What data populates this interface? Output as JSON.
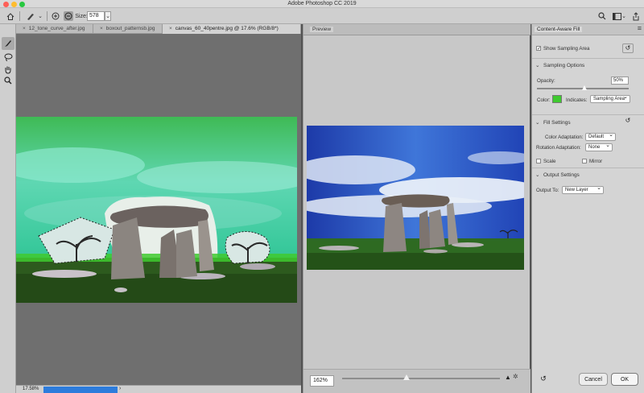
{
  "app": {
    "title": "Adobe Photoshop CC 2019"
  },
  "options": {
    "size_label": "Size:",
    "size_value": "578"
  },
  "tabs": [
    {
      "label": "12_tone_curve_after.jpg"
    },
    {
      "label": "boxout_patternsb.jpg"
    },
    {
      "label": "canvas_60_40pentre.jpg @ 17.6% (RGB/8*)"
    }
  ],
  "status": {
    "zoom": "17.58%"
  },
  "preview": {
    "title": "Preview",
    "zoom": "162%",
    "slider_fraction": 0.41
  },
  "panel": {
    "title": "Content-Aware Fill",
    "show_sampling": "Show Sampling Area",
    "sampling_options": "Sampling Options",
    "opacity_label": "Opacity:",
    "opacity_value": "50%",
    "color_label": "Color:",
    "indicates_label": "Indicates:",
    "indicates_value": "Sampling Area",
    "fill_settings": "Fill Settings",
    "color_adapt_label": "Color Adaptation:",
    "color_adapt_value": "Default",
    "rotation_label": "Rotation Adaptation:",
    "rotation_value": "None",
    "scale_label": "Scale",
    "mirror_label": "Mirror",
    "output_settings": "Output Settings",
    "output_label": "Output To:",
    "output_value": "New Layer",
    "cancel": "Cancel",
    "ok": "OK"
  },
  "colors": {
    "sampling": "#3fca2f",
    "accent": "#2d7cdc"
  }
}
